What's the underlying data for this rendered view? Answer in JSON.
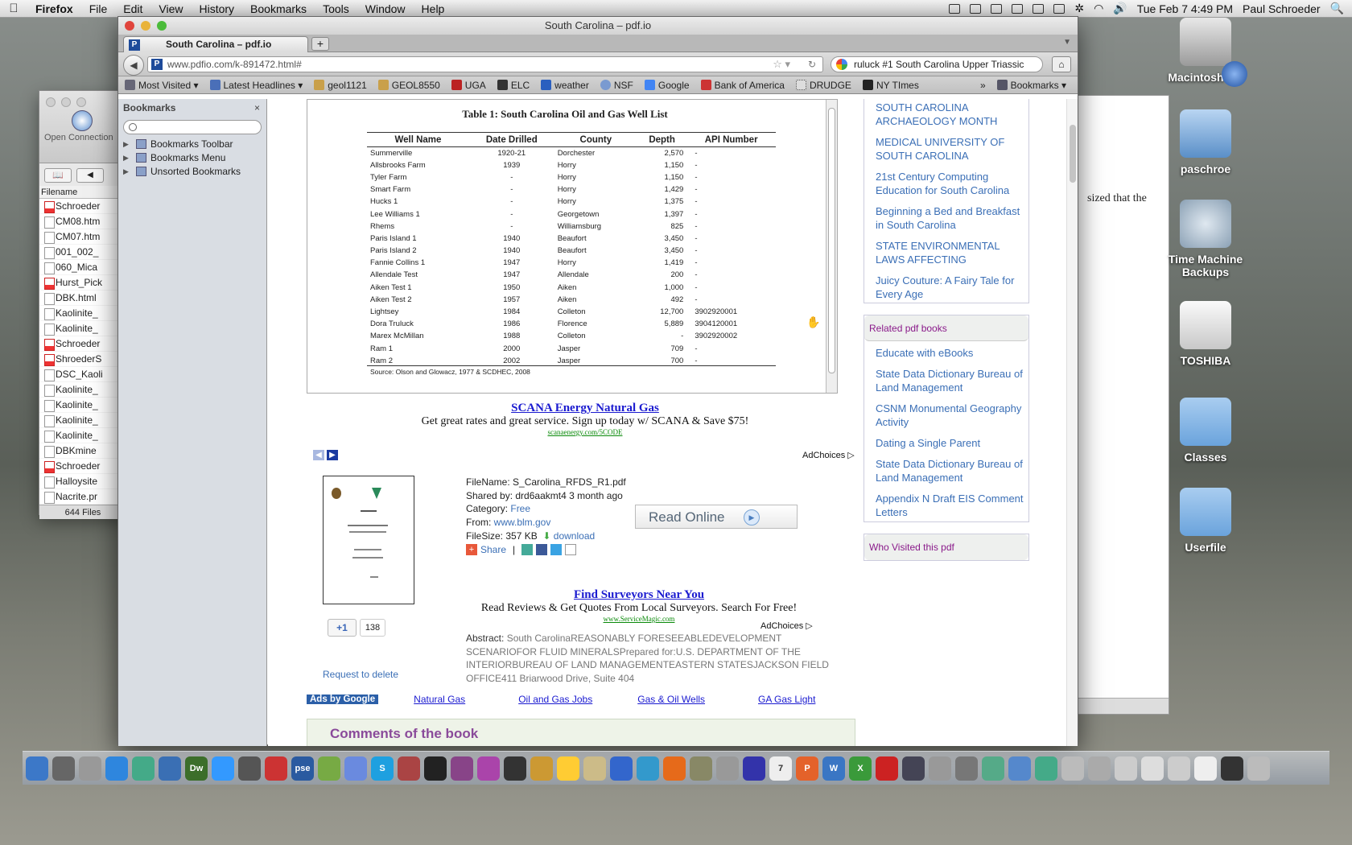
{
  "menubar": {
    "apple": "",
    "items": [
      "Firefox",
      "File",
      "Edit",
      "View",
      "History",
      "Bookmarks",
      "Tools",
      "Window",
      "Help"
    ],
    "clock": "Tue Feb 7  4:49 PM",
    "user": "Paul Schroeder"
  },
  "finder": {
    "open_connection": "Open Connection",
    "header": "Filename",
    "files": [
      {
        "name": "Schroeder",
        "type": "pdf"
      },
      {
        "name": "CM08.htm",
        "type": "doc"
      },
      {
        "name": "CM07.htm",
        "type": "doc"
      },
      {
        "name": "001_002_",
        "type": "doc"
      },
      {
        "name": "060_Mica",
        "type": "doc"
      },
      {
        "name": "Hurst_Pick",
        "type": "pdf"
      },
      {
        "name": "DBK.html",
        "type": "doc"
      },
      {
        "name": "Kaolinite_",
        "type": "doc"
      },
      {
        "name": "Kaolinite_",
        "type": "doc"
      },
      {
        "name": "Schroeder",
        "type": "pdf"
      },
      {
        "name": "ShroederS",
        "type": "pdf"
      },
      {
        "name": "DSC_Kaoli",
        "type": "doc"
      },
      {
        "name": "Kaolinite_",
        "type": "doc"
      },
      {
        "name": "Kaolinite_",
        "type": "doc"
      },
      {
        "name": "Kaolinite_",
        "type": "doc"
      },
      {
        "name": "Kaolinite_",
        "type": "doc"
      },
      {
        "name": "DBKmine",
        "type": "doc"
      },
      {
        "name": "Schroeder",
        "type": "pdf"
      },
      {
        "name": "Halloysite",
        "type": "doc"
      },
      {
        "name": "Nacrite.pr",
        "type": "doc"
      }
    ],
    "count": "644 Files"
  },
  "right_window": {
    "text": "sized that the"
  },
  "desktop_icons": [
    {
      "label": "Macintosh HD",
      "icon": "hard-drive-icon"
    },
    {
      "label": "paschroe",
      "icon": "icloud-drive-icon"
    },
    {
      "label": "Time Machine Backups",
      "icon": "time-machine-icon"
    },
    {
      "label": "TOSHIBA",
      "icon": "external-drive-icon"
    },
    {
      "label": "Classes",
      "icon": "folder-icon"
    },
    {
      "label": "Userfile",
      "icon": "folder-icon"
    }
  ],
  "browser": {
    "window_title": "South Carolina – pdf.io",
    "tab_title": "South Carolina – pdf.io",
    "new_tab": "+",
    "url": "www.pdfio.com/k-891472.html#",
    "search": "ruluck #1  South Carolina Upper Triassic",
    "bookmarks_bar": [
      "Most Visited ▾",
      "Latest Headlines ▾",
      "geol1121",
      "GEOL8550",
      "UGA",
      "ELC",
      "weather",
      "NSF",
      "Google",
      "Bank of America",
      "DRUDGE",
      "NY TImes"
    ],
    "bookmarks_menu": "Bookmarks ▾",
    "overflow": "»"
  },
  "sidebar": {
    "title": "Bookmarks",
    "close": "×",
    "nodes": [
      "Bookmarks Toolbar",
      "Bookmarks Menu",
      "Unsorted Bookmarks"
    ]
  },
  "pdf_table": {
    "title": "Table 1: South Carolina Oil and Gas Well List",
    "columns": [
      "Well Name",
      "Date Drilled",
      "County",
      "Depth",
      "API Number"
    ],
    "rows": [
      [
        "Summerville",
        "1920-21",
        "Dorchester",
        "2,570",
        "-"
      ],
      [
        "Allsbrooks Farm",
        "1939",
        "Horry",
        "1,150",
        "-"
      ],
      [
        "Tyler Farm",
        "-",
        "Horry",
        "1,150",
        "-"
      ],
      [
        "Smart Farm",
        "-",
        "Horry",
        "1,429",
        "-"
      ],
      [
        "Hucks 1",
        "-",
        "Horry",
        "1,375",
        "-"
      ],
      [
        "Lee Williams 1",
        "-",
        "Georgetown",
        "1,397",
        "-"
      ],
      [
        "Rhems",
        "-",
        "Williamsburg",
        "825",
        "-"
      ],
      [
        "Paris Island 1",
        "1940",
        "Beaufort",
        "3,450",
        "-"
      ],
      [
        "Paris Island 2",
        "1940",
        "Beaufort",
        "3,450",
        "-"
      ],
      [
        "Fannie Collins 1",
        "1947",
        "Horry",
        "1,419",
        "-"
      ],
      [
        "Allendale Test",
        "1947",
        "Allendale",
        "200",
        "-"
      ],
      [
        "Aiken Test 1",
        "1950",
        "Aiken",
        "1,000",
        "-"
      ],
      [
        "Aiken Test 2",
        "1957",
        "Aiken",
        "492",
        "-"
      ],
      [
        "Lightsey",
        "1984",
        "Colleton",
        "12,700",
        "3902920001"
      ],
      [
        "Dora Truluck",
        "1986",
        "Florence",
        "5,889",
        "3904120001"
      ],
      [
        "Marex McMillan",
        "1988",
        "Colleton",
        "-",
        "3902920002"
      ],
      [
        "Ram 1",
        "2000",
        "Jasper",
        "709",
        "-"
      ],
      [
        "Ram 2",
        "2002",
        "Jasper",
        "700",
        "-"
      ]
    ],
    "source": "Source: Olson and Glowacz, 1977 & SCDHEC, 2008"
  },
  "ad1": {
    "title": "SCANA Energy Natural Gas",
    "text": "Get great rates and great service. Sign up today w/ SCANA & Save $75!",
    "url": "scanaenergy.com/5CODE",
    "adchoices": "AdChoices"
  },
  "file": {
    "filename": "FileName: S_Carolina_RFDS_R1.pdf",
    "shared": "Shared by: drd6aakmt4 3 month ago",
    "category_label": "Category: ",
    "category": "Free",
    "from_label": "From: ",
    "from": "www.blm.gov",
    "size": "FileSize: 357 KB",
    "download": "download",
    "share": "Share",
    "read_online": "Read Online",
    "plus_one": "+1",
    "plus_count": "138",
    "request_delete": "Request to delete"
  },
  "ad2": {
    "title": "Find Surveyors Near You",
    "text": "Read Reviews & Get Quotes From Local Surveyors. Search For Free!",
    "url": "www.ServiceMagic.com",
    "adchoices": "AdChoices"
  },
  "abstract": {
    "label": "Abstract: ",
    "text": "South CarolinaREASONABLY FORESEEABLEDEVELOPMENT SCENARIOFOR FLUID MINERALSPrepared for:U.S. DEPARTMENT OF THE INTERIORBUREAU OF LAND MANAGEMENTEASTERN STATESJACKSON FIELD OFFICE411 Briarwood Drive, Suite 404"
  },
  "ads_bar": {
    "label": "Ads by Google",
    "links": [
      "Natural Gas",
      "Oil and Gas Jobs",
      "Gas & Oil Wells",
      "GA Gas Light"
    ]
  },
  "comments": {
    "title": "Comments of the book"
  },
  "right_col": {
    "top_links": [
      "SOUTH CAROLINA ARCHAEOLOGY MONTH",
      "MEDICAL UNIVERSITY OF SOUTH CAROLINA",
      "21st Century Computing Education for South Carolina",
      "Beginning a Bed and Breakfast in South Carolina",
      "STATE ENVIRONMENTAL LAWS AFFECTING",
      "Juicy Couture: A Fairy Tale for Every Age"
    ],
    "related_title": "Related pdf books",
    "related_links": [
      "Educate with eBooks",
      "State Data Dictionary Bureau of Land Management",
      "CSNM Monumental Geography Activity",
      "Dating a Single Parent",
      "State Data Dictionary Bureau of Land Management",
      "Appendix N Draft EIS Comment Letters"
    ],
    "visited_title": "Who Visited this pdf"
  },
  "dock": {
    "apps": [
      {
        "label": "",
        "color": "#3c78c8",
        "icon": "finder-icon"
      },
      {
        "label": "",
        "color": "#666",
        "icon": "launchpad-icon"
      },
      {
        "label": "",
        "color": "#999",
        "icon": "preview-icon"
      },
      {
        "label": "",
        "color": "#2e86de",
        "icon": "app-store-icon"
      },
      {
        "label": "",
        "color": "#4a8",
        "icon": "grapher-icon"
      },
      {
        "label": "",
        "color": "#3a6fb4",
        "icon": "chat-icon"
      },
      {
        "label": "Dw",
        "color": "#3c6e2a",
        "icon": "dreamweaver-icon"
      },
      {
        "label": "",
        "color": "#39f",
        "icon": "ichat-icon"
      },
      {
        "label": "",
        "color": "#555",
        "icon": "camera-icon"
      },
      {
        "label": "",
        "color": "#c33",
        "icon": "acrobat-icon"
      },
      {
        "label": "pse",
        "color": "#2a5aa0",
        "icon": "photoshop-elements-icon"
      },
      {
        "label": "",
        "color": "#7a4",
        "icon": "maps-icon"
      },
      {
        "label": "",
        "color": "#6a8adf",
        "icon": "gp-icon"
      },
      {
        "label": "S",
        "color": "#1ea0e0",
        "icon": "skype-icon"
      },
      {
        "label": "",
        "color": "#a44",
        "icon": "pattern-icon"
      },
      {
        "label": "",
        "color": "#222",
        "icon": "terminal-icon"
      },
      {
        "label": "",
        "color": "#848",
        "icon": "puzzle-icon"
      },
      {
        "label": "",
        "color": "#a4a",
        "icon": "grid-icon"
      },
      {
        "label": "",
        "color": "#333",
        "icon": "record-icon"
      },
      {
        "label": "",
        "color": "#c93",
        "icon": "guitar-icon"
      },
      {
        "label": "",
        "color": "#fc3",
        "icon": "cyberduck-icon"
      },
      {
        "label": "",
        "color": "#cb8",
        "icon": "notes-icon"
      },
      {
        "label": "",
        "color": "#3366cc",
        "icon": "globe-icon"
      },
      {
        "label": "",
        "color": "#39c",
        "icon": "safari-icon"
      },
      {
        "label": "",
        "color": "#e66a1a",
        "icon": "firefox-icon"
      },
      {
        "label": "",
        "color": "#886",
        "icon": "photo-icon"
      },
      {
        "label": "",
        "color": "#999",
        "icon": "preview2-icon"
      },
      {
        "label": "",
        "color": "#33a",
        "icon": "itunes-icon"
      },
      {
        "label": "7",
        "color": "#eee",
        "icon": "calendar-icon"
      },
      {
        "label": "P",
        "color": "#e4622a",
        "icon": "powerpoint-icon"
      },
      {
        "label": "W",
        "color": "#3a76c4",
        "icon": "word-icon"
      },
      {
        "label": "X",
        "color": "#3a9a3a",
        "icon": "excel-icon"
      },
      {
        "label": "",
        "color": "#c22",
        "icon": "acrobat2-icon"
      },
      {
        "label": "",
        "color": "#445",
        "icon": "time-machine-dock-icon"
      },
      {
        "label": "",
        "color": "#999",
        "icon": "calculator-icon"
      },
      {
        "label": "",
        "color": "#777",
        "icon": "system-preferences-icon"
      },
      {
        "label": "",
        "color": "#5a8",
        "icon": "printer-icon"
      },
      {
        "label": "",
        "color": "#58c",
        "icon": "downloads-icon"
      },
      {
        "label": "",
        "color": "#4a8",
        "icon": "network-icon"
      },
      {
        "label": "",
        "color": "#bbb",
        "icon": "utility-icon"
      },
      {
        "label": "",
        "color": "#aaa",
        "icon": "doc-icon"
      },
      {
        "label": "",
        "color": "#ccc",
        "icon": "stack-icon"
      },
      {
        "label": "",
        "color": "#ddd",
        "icon": "stack2-icon"
      },
      {
        "label": "",
        "color": "#ccc",
        "icon": "stack3-icon"
      },
      {
        "label": "",
        "color": "#eee",
        "icon": "stack4-icon"
      },
      {
        "label": "",
        "color": "#333",
        "icon": "screen-icon"
      },
      {
        "label": "",
        "color": "#bbb",
        "icon": "trash-icon"
      }
    ]
  }
}
